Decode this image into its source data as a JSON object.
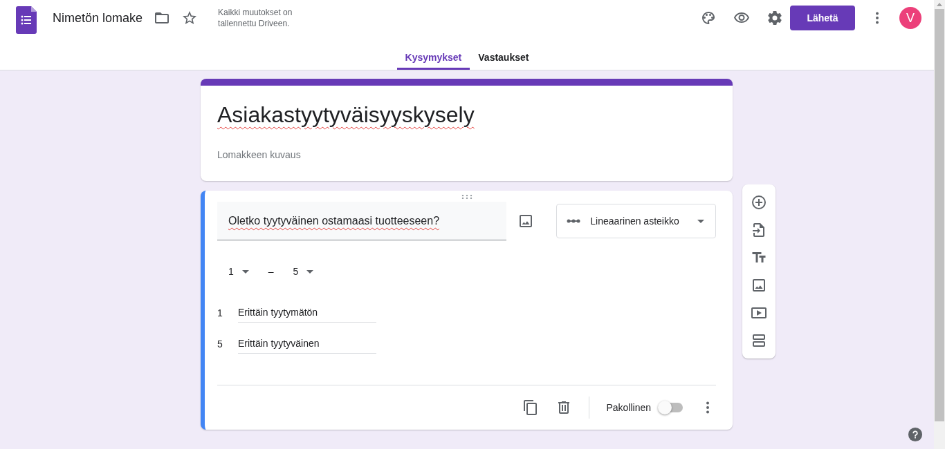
{
  "header": {
    "title": "Nimetön lomake",
    "save_status": "Kaikki muutokset on tallennettu Driveen.",
    "send_button": "Lähetä",
    "avatar": "V"
  },
  "tabs": [
    {
      "label": "Kysymykset",
      "selected": true
    },
    {
      "label": "Vastaukset",
      "selected": false
    }
  ],
  "form": {
    "title": "Asiakastyytyväisyyskysely",
    "description": {
      "placeholder": "Lomakkeen kuvaus"
    }
  },
  "question": {
    "title": "Oletko tyytyväinen ostamaasi tuotteeseen?",
    "type": "Lineaarinen asteikko",
    "scale_min": "1",
    "scale_separator": "–",
    "scale_max": "5",
    "labels": [
      {
        "value": "1",
        "label": "Erittäin tyytymätön"
      },
      {
        "value": "5",
        "label": "Erittäin tyytyväinen"
      }
    ],
    "required_label": "Pakollinen",
    "required": false
  }
}
